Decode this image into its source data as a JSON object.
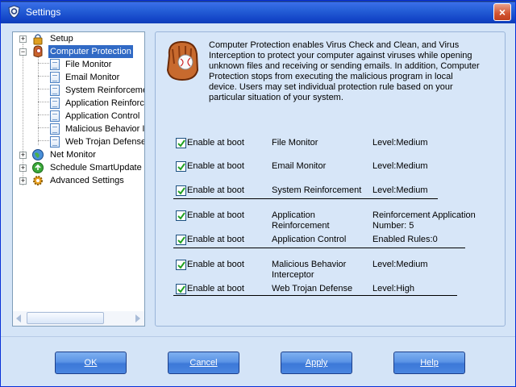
{
  "window": {
    "title": "Settings",
    "close_glyph": "×"
  },
  "tree": {
    "items": [
      {
        "label": "Setup",
        "icon": "lock-icon",
        "expander": "+"
      },
      {
        "label": "Computer Protection",
        "icon": "mitt-icon",
        "expander": "−",
        "selected": true
      },
      {
        "label": "File Monitor",
        "icon": "document-icon"
      },
      {
        "label": "Email Monitor",
        "icon": "document-icon"
      },
      {
        "label": "System Reinforceme",
        "icon": "document-icon"
      },
      {
        "label": "Application Reinforc",
        "icon": "document-icon"
      },
      {
        "label": "Application Control",
        "icon": "document-icon"
      },
      {
        "label": "Malicious Behavior I",
        "icon": "document-icon"
      },
      {
        "label": "Web Trojan Defense",
        "icon": "document-icon"
      },
      {
        "label": "Net Monitor",
        "icon": "globe-icon",
        "expander": "+"
      },
      {
        "label": "Schedule SmartUpdate",
        "icon": "update-icon",
        "expander": "+"
      },
      {
        "label": "Advanced Settings",
        "icon": "gear-icon",
        "expander": "+"
      }
    ]
  },
  "content": {
    "description": "Computer Protection enables Virus Check and Clean, and Virus Interception to protect your computer against viruses while opening unknown files and receiving or sending emails. In addition, Computer Protection stops from executing the malicious program in local device. Users may set individual protection rule based on your particular situation of your system.",
    "options": [
      {
        "checkbox_label": "Enable at boot",
        "checked": true,
        "name": "File Monitor",
        "level": "Level:Medium"
      },
      {
        "checkbox_label": "Enable at boot",
        "checked": true,
        "name": "Email Monitor",
        "level": "Level:Medium"
      },
      {
        "checkbox_label": "Enable at boot",
        "checked": true,
        "name": "System Reinforcement",
        "level": "Level:Medium"
      },
      {
        "checkbox_label": "Enable at boot",
        "checked": true,
        "name": "Application Reinforcement",
        "level": "Reinforcement Application Number: 5"
      },
      {
        "checkbox_label": "Enable at boot",
        "checked": true,
        "name": "Application Control",
        "level": "Enabled Rules:0"
      },
      {
        "checkbox_label": "Enable at boot",
        "checked": true,
        "name": "Malicious Behavior Interceptor",
        "level": "Level:Medium"
      },
      {
        "checkbox_label": "Enable at boot",
        "checked": true,
        "name": "Web Trojan Defense",
        "level": "Level:High"
      }
    ]
  },
  "buttons": {
    "ok": "OK",
    "cancel": "Cancel",
    "apply": "Apply",
    "help": "Help"
  },
  "colors": {
    "titlebar": "#2660d8",
    "client_bg": "#d4e4f7",
    "selection": "#316ac5",
    "button": "#4a86e0"
  }
}
